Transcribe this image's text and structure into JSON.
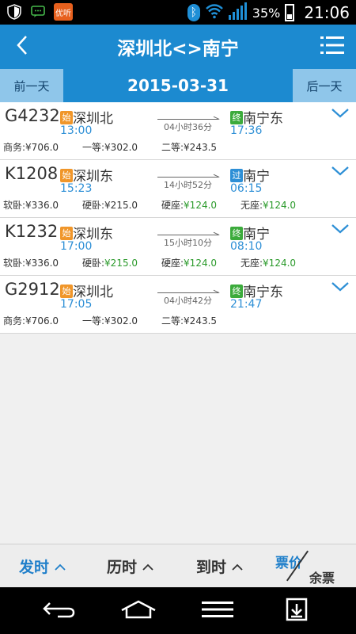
{
  "status_bar": {
    "notif_app_label": "优听",
    "battery": "35%",
    "time": "21:06"
  },
  "header": {
    "title": "深圳北<>南宁"
  },
  "date_bar": {
    "prev_label": "前一天",
    "date": "2015-03-31",
    "next_label": "后一天"
  },
  "trains": [
    {
      "number": "G4232",
      "dep_badge": "始",
      "dep_station": "深圳北",
      "dep_time": "13:00",
      "duration": "04小时36分",
      "arr_badge": "终",
      "arr_station": "南宁东",
      "arr_time": "17:36",
      "prices": [
        {
          "label": "商务:",
          "value": "¥706.0",
          "avail": false
        },
        {
          "label": "一等:",
          "value": "¥302.0",
          "avail": false
        },
        {
          "label": "二等:",
          "value": "¥243.5",
          "avail": false
        }
      ]
    },
    {
      "number": "K1208",
      "dep_badge": "始",
      "dep_station": "深圳东",
      "dep_time": "15:23",
      "duration": "14小时52分",
      "arr_badge": "过",
      "arr_station": "南宁",
      "arr_time": "06:15",
      "prices": [
        {
          "label": "软卧:",
          "value": "¥336.0",
          "avail": false
        },
        {
          "label": "硬卧:",
          "value": "¥215.0",
          "avail": false
        },
        {
          "label": "硬座:",
          "value": "¥124.0",
          "avail": true
        },
        {
          "label": "无座:",
          "value": "¥124.0",
          "avail": true
        }
      ]
    },
    {
      "number": "K1232",
      "dep_badge": "始",
      "dep_station": "深圳东",
      "dep_time": "17:00",
      "duration": "15小时10分",
      "arr_badge": "终",
      "arr_station": "南宁",
      "arr_time": "08:10",
      "prices": [
        {
          "label": "软卧:",
          "value": "¥336.0",
          "avail": false
        },
        {
          "label": "硬卧:",
          "value": "¥215.0",
          "avail": true
        },
        {
          "label": "硬座:",
          "value": "¥124.0",
          "avail": true
        },
        {
          "label": "无座:",
          "value": "¥124.0",
          "avail": true
        }
      ]
    },
    {
      "number": "G2912",
      "dep_badge": "始",
      "dep_station": "深圳北",
      "dep_time": "17:05",
      "duration": "04小时42分",
      "arr_badge": "终",
      "arr_station": "南宁东",
      "arr_time": "21:47",
      "prices": [
        {
          "label": "商务:",
          "value": "¥706.0",
          "avail": false
        },
        {
          "label": "一等:",
          "value": "¥302.0",
          "avail": false
        },
        {
          "label": "二等:",
          "value": "¥243.5",
          "avail": false
        }
      ]
    }
  ],
  "sort_bar": {
    "depart": "发时",
    "duration": "历时",
    "arrive": "到时",
    "price": "票价",
    "remaining": "余票"
  },
  "colors": {
    "primary": "#1c8ad0",
    "available": "#2b9a2b",
    "badge_start": "#f0962a",
    "badge_end": "#3cab3c",
    "badge_pass": "#2d8fd6"
  }
}
